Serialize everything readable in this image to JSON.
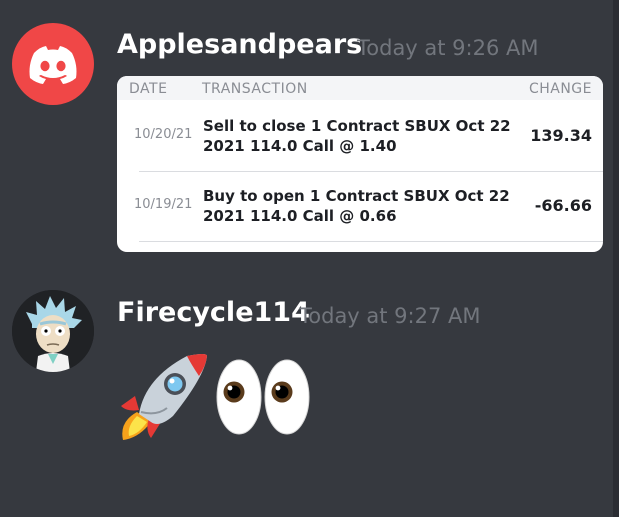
{
  "messages": [
    {
      "username": "Applesandpears",
      "timestamp": "Today at 9:26 AM",
      "avatar_icon": "discord-logo-icon",
      "embed": {
        "columns": [
          "DATE",
          "TRANSACTION",
          "CHANGE"
        ],
        "rows": [
          {
            "date": "10/20/21",
            "line1": "Sell to close 1 Contract SBUX Oct 22",
            "line2": "2021 114.0 Call @ 1.40",
            "change": "139.34"
          },
          {
            "date": "10/19/21",
            "line1": "Buy to open 1 Contract SBUX Oct 22",
            "line2": "2021 114.0 Call @ 0.66",
            "change": "-66.66"
          }
        ]
      }
    },
    {
      "username": "Firecycle114",
      "timestamp": "Today at 9:27 AM",
      "avatar_icon": "rick-avatar-icon",
      "emojis": [
        "rocket-emoji-icon",
        "eyes-emoji-icon"
      ]
    }
  ],
  "colors": {
    "background": "#36393f",
    "discord_red": "#f04747",
    "username": "#ffffff",
    "timestamp": "#72767d",
    "embed_bg": "#ffffff",
    "embed_header_bg": "#f4f5f7"
  }
}
